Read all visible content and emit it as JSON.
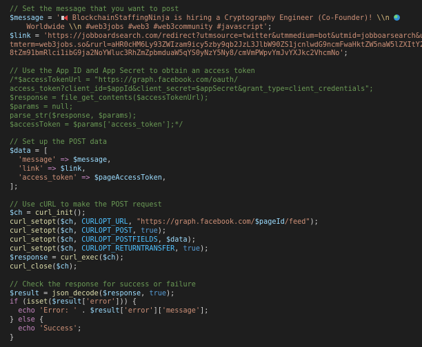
{
  "editor": {
    "lines": [
      {
        "tokens": [
          {
            "t": "// Set the message that you want to post",
            "c": "c"
          }
        ]
      },
      {
        "tokens": [
          {
            "t": "$message",
            "c": "v"
          },
          {
            "t": " = ",
            "c": "o"
          },
          {
            "t": "'",
            "c": "s"
          },
          {
            "icon": "megaphone-icon"
          },
          {
            "t": " BlockchainStaffingNinja is hiring a Cryptography Engineer (Co-Founder)! ",
            "c": "s"
          },
          {
            "t": "\\\\n",
            "c": "e"
          },
          {
            "t": " ",
            "c": "s"
          },
          {
            "icon": "globe-icon"
          }
        ]
      },
      {
        "tokens": [
          {
            "t": "    Worldwide ",
            "c": "s"
          },
          {
            "t": "\\\\n",
            "c": "e"
          },
          {
            "t": " #web3jobs #web3 #web3community #javascript'",
            "c": "s"
          },
          {
            "t": ";",
            "c": "o"
          }
        ]
      },
      {
        "tokens": [
          {
            "t": "$link",
            "c": "v"
          },
          {
            "t": " = ",
            "c": "o"
          },
          {
            "t": "'https://jobboardsearch.com/redirect?utmsource=twitter&utmmedium=bot&utmid=jobboarsearch&u",
            "c": "s"
          }
        ]
      },
      {
        "tokens": [
          {
            "t": "tmterm=web3jobs.so&rurl=aHR0cHM6Ly93ZWIzam9icy5zby9qb2JzL3JlbW90ZS1jcnlwdG9ncmFwaHktZW5naW5lZXItY2",
            "c": "s"
          }
        ]
      },
      {
        "tokens": [
          {
            "t": "8tZm91bmRlci1ibG9ja2NoYWluc3RhZmZpbmduaW5qYS0yNzY5Ny8/cmVmPWpvYmJvYXJkc2VhcmNo'",
            "c": "s"
          },
          {
            "t": ";",
            "c": "o"
          }
        ]
      },
      {
        "tokens": []
      },
      {
        "tokens": [
          {
            "t": "// Use the App ID and App Secret to obtain an access token",
            "c": "c"
          }
        ]
      },
      {
        "tokens": [
          {
            "t": "/*$accessTokenUrl = \"https://graph.facebook.com/oauth/",
            "c": "c"
          }
        ]
      },
      {
        "tokens": [
          {
            "t": "access_token?client_id=$appId&client_secret=$appSecret&grant_type=client_credentials\";",
            "c": "c"
          }
        ]
      },
      {
        "tokens": [
          {
            "t": "$response = file_get_contents($accessTokenUrl);",
            "c": "c"
          }
        ]
      },
      {
        "tokens": [
          {
            "t": "$params = null;",
            "c": "c"
          }
        ]
      },
      {
        "tokens": [
          {
            "t": "parse_str($response, $params);",
            "c": "c"
          }
        ]
      },
      {
        "tokens": [
          {
            "t": "$accessToken = $params['access_token'];*/",
            "c": "c"
          }
        ]
      },
      {
        "tokens": []
      },
      {
        "tokens": [
          {
            "t": "// Set up the POST data",
            "c": "c"
          }
        ]
      },
      {
        "tokens": [
          {
            "t": "$data",
            "c": "v"
          },
          {
            "t": " = [",
            "c": "o"
          }
        ]
      },
      {
        "tokens": [
          {
            "t": "  ",
            "c": "o"
          },
          {
            "t": "'message'",
            "c": "s"
          },
          {
            "t": " => ",
            "c": "k"
          },
          {
            "t": "$message",
            "c": "v"
          },
          {
            "t": ",",
            "c": "o"
          }
        ]
      },
      {
        "tokens": [
          {
            "t": "  ",
            "c": "o"
          },
          {
            "t": "'link'",
            "c": "s"
          },
          {
            "t": " => ",
            "c": "k"
          },
          {
            "t": "$link",
            "c": "v"
          },
          {
            "t": ",",
            "c": "o"
          }
        ]
      },
      {
        "tokens": [
          {
            "t": "  ",
            "c": "o"
          },
          {
            "t": "'access_token'",
            "c": "s"
          },
          {
            "t": " => ",
            "c": "k"
          },
          {
            "t": "$pageAccessToken",
            "c": "v"
          },
          {
            "t": ",",
            "c": "o"
          }
        ]
      },
      {
        "tokens": [
          {
            "t": "];",
            "c": "o"
          }
        ]
      },
      {
        "tokens": []
      },
      {
        "tokens": [
          {
            "t": "// Use cURL to make the POST request",
            "c": "c"
          }
        ]
      },
      {
        "tokens": [
          {
            "t": "$ch",
            "c": "v"
          },
          {
            "t": " = ",
            "c": "o"
          },
          {
            "t": "curl_init",
            "c": "f"
          },
          {
            "t": "();",
            "c": "o"
          }
        ]
      },
      {
        "tokens": [
          {
            "t": "curl_setopt",
            "c": "f"
          },
          {
            "t": "(",
            "c": "o"
          },
          {
            "t": "$ch",
            "c": "v"
          },
          {
            "t": ", ",
            "c": "o"
          },
          {
            "t": "CURLOPT_URL",
            "c": "n"
          },
          {
            "t": ", ",
            "c": "o"
          },
          {
            "t": "\"https://graph.facebook.com/",
            "c": "s"
          },
          {
            "t": "$pageId",
            "c": "v"
          },
          {
            "t": "/feed\"",
            "c": "s"
          },
          {
            "t": ");",
            "c": "o"
          }
        ]
      },
      {
        "tokens": [
          {
            "t": "curl_setopt",
            "c": "f"
          },
          {
            "t": "(",
            "c": "o"
          },
          {
            "t": "$ch",
            "c": "v"
          },
          {
            "t": ", ",
            "c": "o"
          },
          {
            "t": "CURLOPT_POST",
            "c": "n"
          },
          {
            "t": ", ",
            "c": "o"
          },
          {
            "t": "true",
            "c": "b"
          },
          {
            "t": ");",
            "c": "o"
          }
        ]
      },
      {
        "tokens": [
          {
            "t": "curl_setopt",
            "c": "f"
          },
          {
            "t": "(",
            "c": "o"
          },
          {
            "t": "$ch",
            "c": "v"
          },
          {
            "t": ", ",
            "c": "o"
          },
          {
            "t": "CURLOPT_POSTFIELDS",
            "c": "n"
          },
          {
            "t": ", ",
            "c": "o"
          },
          {
            "t": "$data",
            "c": "v"
          },
          {
            "t": ");",
            "c": "o"
          }
        ]
      },
      {
        "tokens": [
          {
            "t": "curl_setopt",
            "c": "f"
          },
          {
            "t": "(",
            "c": "o"
          },
          {
            "t": "$ch",
            "c": "v"
          },
          {
            "t": ", ",
            "c": "o"
          },
          {
            "t": "CURLOPT_RETURNTRANSFER",
            "c": "n"
          },
          {
            "t": ", ",
            "c": "o"
          },
          {
            "t": "true",
            "c": "b"
          },
          {
            "t": ");",
            "c": "o"
          }
        ]
      },
      {
        "tokens": [
          {
            "t": "$response",
            "c": "v"
          },
          {
            "t": " = ",
            "c": "o"
          },
          {
            "t": "curl_exec",
            "c": "f"
          },
          {
            "t": "(",
            "c": "o"
          },
          {
            "t": "$ch",
            "c": "v"
          },
          {
            "t": ");",
            "c": "o"
          }
        ]
      },
      {
        "tokens": [
          {
            "t": "curl_close",
            "c": "f"
          },
          {
            "t": "(",
            "c": "o"
          },
          {
            "t": "$ch",
            "c": "v"
          },
          {
            "t": ");",
            "c": "o"
          }
        ]
      },
      {
        "tokens": []
      },
      {
        "tokens": [
          {
            "t": "// Check the response for success or failure",
            "c": "c"
          }
        ]
      },
      {
        "tokens": [
          {
            "t": "$result",
            "c": "v"
          },
          {
            "t": " = ",
            "c": "o"
          },
          {
            "t": "json_decode",
            "c": "f"
          },
          {
            "t": "(",
            "c": "o"
          },
          {
            "t": "$response",
            "c": "v"
          },
          {
            "t": ", ",
            "c": "o"
          },
          {
            "t": "true",
            "c": "b"
          },
          {
            "t": ");",
            "c": "o"
          }
        ]
      },
      {
        "tokens": [
          {
            "t": "if",
            "c": "k"
          },
          {
            "t": " (",
            "c": "o"
          },
          {
            "t": "isset",
            "c": "f"
          },
          {
            "t": "(",
            "c": "o"
          },
          {
            "t": "$result",
            "c": "v"
          },
          {
            "t": "[",
            "c": "o"
          },
          {
            "t": "'error'",
            "c": "s"
          },
          {
            "t": "])) {",
            "c": "o"
          }
        ]
      },
      {
        "tokens": [
          {
            "t": "  ",
            "c": "o"
          },
          {
            "t": "echo",
            "c": "k"
          },
          {
            "t": " ",
            "c": "o"
          },
          {
            "t": "'Error: '",
            "c": "s"
          },
          {
            "t": " . ",
            "c": "o"
          },
          {
            "t": "$result",
            "c": "v"
          },
          {
            "t": "[",
            "c": "o"
          },
          {
            "t": "'error'",
            "c": "s"
          },
          {
            "t": "][",
            "c": "o"
          },
          {
            "t": "'message'",
            "c": "s"
          },
          {
            "t": "];",
            "c": "o"
          }
        ]
      },
      {
        "tokens": [
          {
            "t": "} ",
            "c": "o"
          },
          {
            "t": "else",
            "c": "k"
          },
          {
            "t": " {",
            "c": "o"
          }
        ]
      },
      {
        "tokens": [
          {
            "t": "  ",
            "c": "o"
          },
          {
            "t": "echo",
            "c": "k"
          },
          {
            "t": " ",
            "c": "o"
          },
          {
            "t": "'Success'",
            "c": "s"
          },
          {
            "t": ";",
            "c": "o"
          }
        ]
      },
      {
        "tokens": [
          {
            "t": "}",
            "c": "o"
          }
        ]
      }
    ]
  }
}
